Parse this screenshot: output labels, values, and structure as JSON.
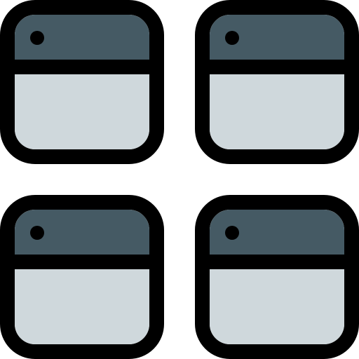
{
  "icon": {
    "name": "app-grid-windows-icon",
    "colors": {
      "outline": "#000000",
      "titlebar": "#455a64",
      "window_body": "#cfd8dc",
      "background": "#ffffff"
    },
    "tiles": [
      {
        "id": "top-left"
      },
      {
        "id": "top-right"
      },
      {
        "id": "bottom-left"
      },
      {
        "id": "bottom-right"
      }
    ]
  }
}
